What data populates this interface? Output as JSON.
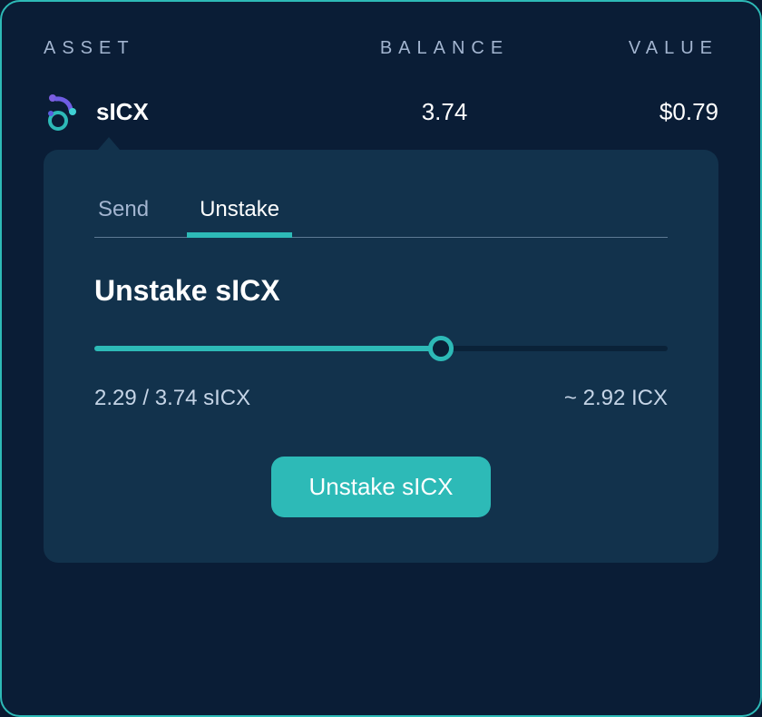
{
  "headers": {
    "asset": "ASSET",
    "balance": "BALANCE",
    "value": "VALUE"
  },
  "asset": {
    "name": "sICX",
    "balance": "3.74",
    "value": "$0.79"
  },
  "tabs": {
    "send": "Send",
    "unstake": "Unstake"
  },
  "section": {
    "title": "Unstake sICX",
    "selected_amount": "2.29 / 3.74 sICX",
    "equivalent": "~ 2.92 ICX"
  },
  "action": {
    "label": "Unstake sICX"
  },
  "slider": {
    "percent": 60.5
  }
}
